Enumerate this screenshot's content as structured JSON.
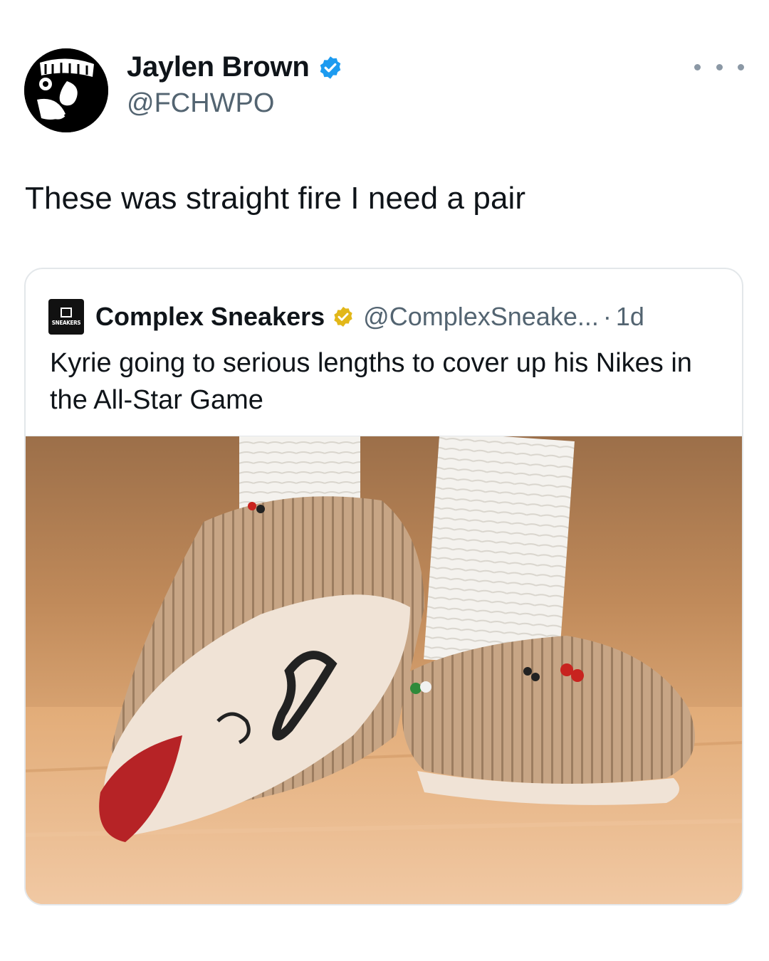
{
  "tweet": {
    "author": {
      "name": "Jaylen Brown",
      "handle": "@FCHWPO",
      "avatar_icon": "liber-logo-avatar",
      "verified_color": "#1d9bf0"
    },
    "text": "These was straight fire I need a pair",
    "more_icon": "ellipsis-icon"
  },
  "quote": {
    "author": {
      "name": "Complex Sneakers",
      "handle": "@ComplexSneake...",
      "avatar_icon": "complex-sneakers-logo",
      "avatar_text": "SNEAKERS",
      "verified_color": "#e2b719"
    },
    "separator": "·",
    "time": "1d",
    "text": "Kyrie going to serious lengths to cover up his Nikes in the All-Star Game",
    "media_icon": "fringed-moccasin-sneakers-photo"
  },
  "colors": {
    "text_primary": "#0f1419",
    "text_secondary": "#536471",
    "border": "#e3e7ea"
  }
}
